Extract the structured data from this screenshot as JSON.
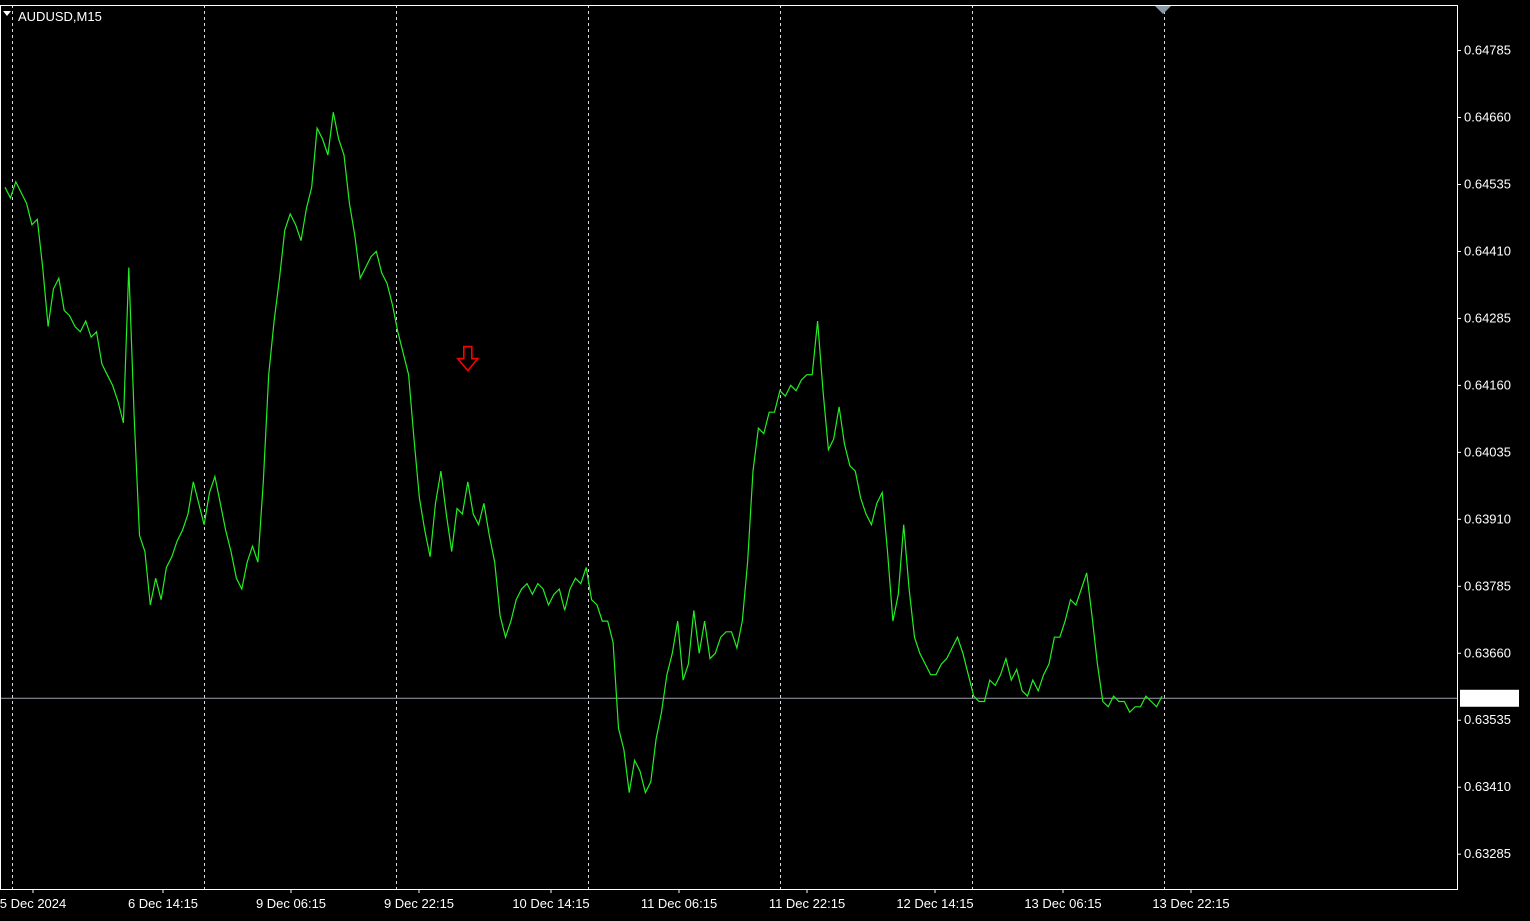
{
  "window": {
    "symbol_title": "AUDUSD,M15"
  },
  "colors": {
    "background": "#000000",
    "price_line": "#22ee22",
    "grid": "#ffffff",
    "frame": "#ffffff",
    "current_price_line": "#9aa3ab",
    "sell_arrow": "#ff0000",
    "current_price_label_bg": "#ffffff",
    "current_price_label_text": "#000000"
  },
  "chart_data": {
    "type": "line",
    "symbol": "AUDUSD",
    "timeframe": "M15",
    "ylim": [
      0.6322,
      0.6487
    ],
    "y_ticks": [
      "0.64785",
      "0.64660",
      "0.64535",
      "0.64410",
      "0.64285",
      "0.64160",
      "0.64035",
      "0.63910",
      "0.63785",
      "0.63660",
      "0.63535",
      "0.63410",
      "0.63285"
    ],
    "x_ticks": [
      "5 Dec 2024",
      "6 Dec 14:15",
      "9 Dec 06:15",
      "9 Dec 22:15",
      "10 Dec 14:15",
      "11 Dec 06:15",
      "11 Dec 22:15",
      "12 Dec 14:15",
      "13 Dec 06:15",
      "13 Dec 22:15"
    ],
    "grid": "vertical dashed at every x tick",
    "current_price": "0.63576",
    "current_price_value": 0.63576,
    "sell_arrow": {
      "bar": 86,
      "price": 0.6421
    },
    "series": [
      {
        "values": [
          0.6453,
          0.6451,
          0.6454,
          0.6452,
          0.645,
          0.6446,
          0.6447,
          0.6438,
          0.6427,
          0.6434,
          0.6436,
          0.643,
          0.6429,
          0.6427,
          0.6426,
          0.6428,
          0.6425,
          0.6426,
          0.642,
          0.6418,
          0.6416,
          0.6413,
          0.6409,
          0.6438,
          0.641,
          0.6388,
          0.6385,
          0.6375,
          0.638,
          0.6376,
          0.6382,
          0.6384,
          0.6387,
          0.6389,
          0.6392,
          0.6398,
          0.6394,
          0.639,
          0.6396,
          0.6399,
          0.6394,
          0.6389,
          0.6385,
          0.638,
          0.6378,
          0.6383,
          0.6386,
          0.6383,
          0.6398,
          0.6418,
          0.6428,
          0.6436,
          0.6445,
          0.6448,
          0.6446,
          0.6443,
          0.6449,
          0.6453,
          0.6464,
          0.6462,
          0.6459,
          0.6467,
          0.6462,
          0.6459,
          0.645,
          0.6444,
          0.6436,
          0.6438,
          0.644,
          0.6441,
          0.6437,
          0.6435,
          0.6431,
          0.6426,
          0.6422,
          0.6418,
          0.6406,
          0.6395,
          0.6389,
          0.6384,
          0.6394,
          0.64,
          0.6392,
          0.6385,
          0.6393,
          0.6392,
          0.6398,
          0.6392,
          0.639,
          0.6394,
          0.6388,
          0.6383,
          0.6373,
          0.6369,
          0.6372,
          0.6376,
          0.6378,
          0.6379,
          0.6377,
          0.6379,
          0.6378,
          0.6375,
          0.6377,
          0.6378,
          0.6374,
          0.6378,
          0.638,
          0.6379,
          0.6382,
          0.6376,
          0.6375,
          0.6372,
          0.6372,
          0.6368,
          0.6352,
          0.6348,
          0.634,
          0.6346,
          0.6344,
          0.634,
          0.6342,
          0.635,
          0.6355,
          0.6362,
          0.6366,
          0.6372,
          0.6361,
          0.6364,
          0.6374,
          0.6366,
          0.6372,
          0.6365,
          0.6366,
          0.6369,
          0.637,
          0.637,
          0.6367,
          0.6372,
          0.6383,
          0.64,
          0.6408,
          0.6407,
          0.6411,
          0.6411,
          0.6415,
          0.6414,
          0.6416,
          0.6415,
          0.6417,
          0.6418,
          0.6418,
          0.6428,
          0.6415,
          0.6404,
          0.6406,
          0.6412,
          0.6405,
          0.6401,
          0.64,
          0.6395,
          0.6392,
          0.639,
          0.6394,
          0.6396,
          0.6385,
          0.6372,
          0.6377,
          0.639,
          0.6378,
          0.6369,
          0.6366,
          0.6364,
          0.6362,
          0.6362,
          0.6364,
          0.6365,
          0.6367,
          0.6369,
          0.6366,
          0.6362,
          0.6358,
          0.6357,
          0.6357,
          0.6361,
          0.636,
          0.6362,
          0.6365,
          0.6361,
          0.6363,
          0.6359,
          0.6358,
          0.6361,
          0.6359,
          0.6362,
          0.6364,
          0.6369,
          0.6369,
          0.6372,
          0.6376,
          0.6375,
          0.6378,
          0.6381,
          0.6373,
          0.6364,
          0.6357,
          0.6356,
          0.6358,
          0.6357,
          0.6357,
          0.6355,
          0.6356,
          0.6356,
          0.6358,
          0.6357,
          0.6356,
          0.6358
        ]
      }
    ]
  }
}
